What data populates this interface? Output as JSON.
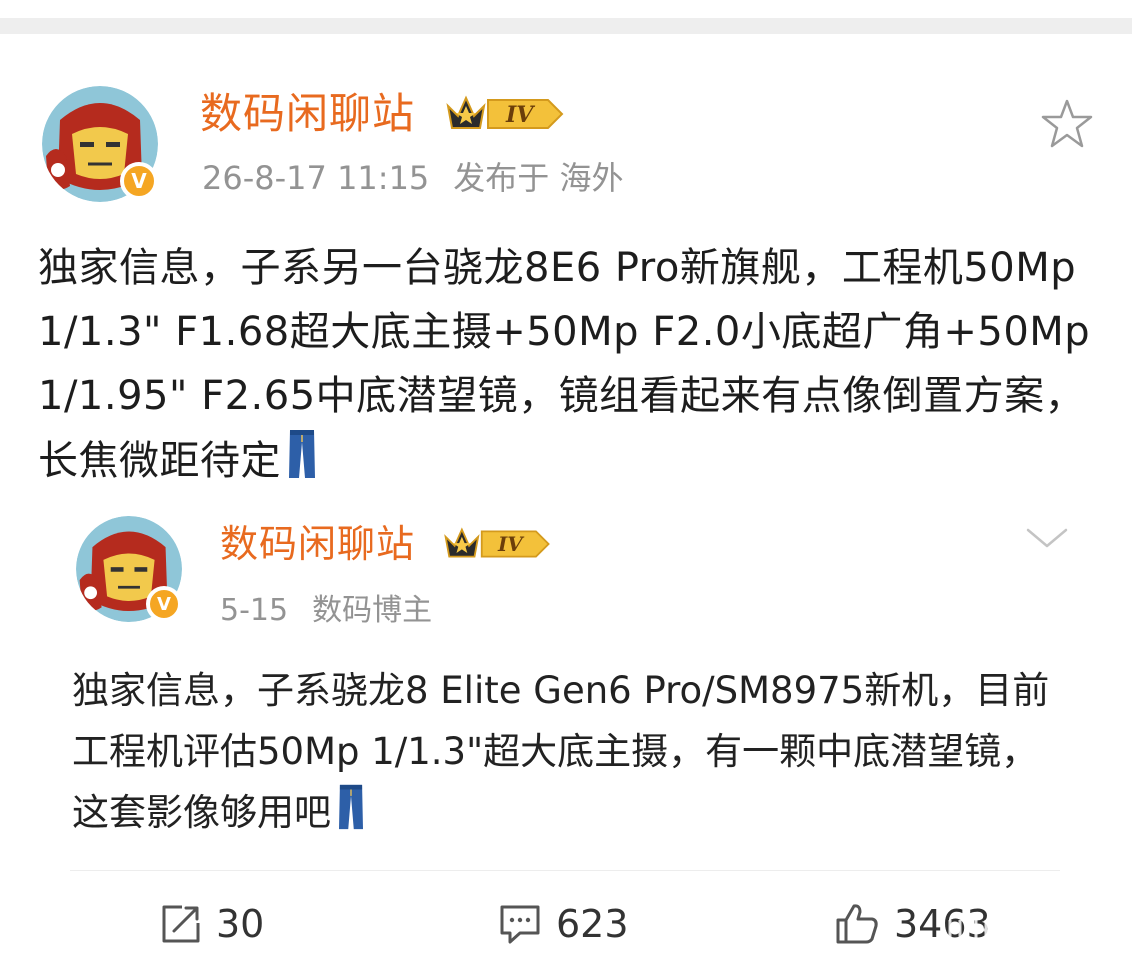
{
  "post": {
    "author": "数码闲聊站",
    "level_badge": "IV",
    "timestamp": "26-8-17 11:15",
    "location": "发布于 海外",
    "text": "独家信息，子系另一台骁龙8E6 Pro新旗舰，工程机50Mp 1/1.3\" F1.68超大底主摄+50Mp F2.0小底超广角+50Mp 1/1.95\" F2.65中底潜望镜，镜组看起来有点像倒置方案，长焦微距待定",
    "emoji": "jeans-emoji"
  },
  "repost": {
    "author": "数码闲聊站",
    "level_badge": "IV",
    "date": "5-15",
    "role": "数码博主",
    "text": "独家信息，子系骁龙8 Elite Gen6 Pro/SM8975新机，目前工程机评估50Mp 1/1.3\"超大底主摄，有一颗中底潜望镜，这套影像够用吧",
    "emoji": "jeans-emoji"
  },
  "actions": {
    "share_count": "30",
    "comment_count": "623",
    "like_count": "3463"
  },
  "colors": {
    "author_name": "#e86a1f",
    "meta_text": "#939393",
    "badge_gold": "#f5a623",
    "verified": "#f5a623"
  },
  "icons": [
    "star-icon",
    "chevron-down-icon",
    "share-icon",
    "comment-icon",
    "like-icon",
    "crown-badge-icon",
    "verified-v-icon",
    "jeans-emoji"
  ]
}
